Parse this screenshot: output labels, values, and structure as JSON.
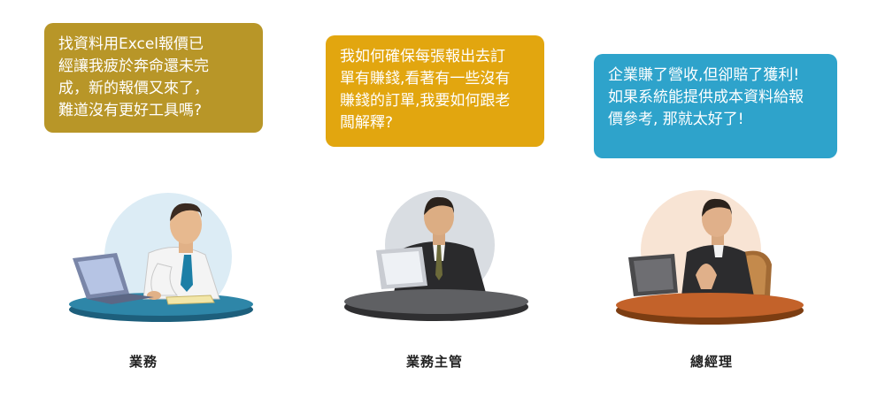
{
  "colors": {
    "bubble_sales": "#b89628",
    "bubble_supervisor": "#e2a60f",
    "bubble_manager": "#2ea3cb"
  },
  "speech": {
    "sales": {
      "lines": [
        "找資料用Excel報價已",
        "經讓我疲於奔命還未完",
        "成，新的報價又來了，",
        "難道沒有更好工具嗎?"
      ]
    },
    "supervisor": {
      "lines": [
        "我如何確保每張報出去訂",
        "單有賺錢,看著有一些沒有",
        "賺錢的訂單,我要如何跟老",
        "闆解釋?"
      ]
    },
    "manager": {
      "lines": [
        "企業賺了營收,但卻賠了獲利!",
        "如果系統能提供成本資料給報",
        "價參考, 那就太好了!"
      ]
    }
  },
  "roles": {
    "sales": "業務",
    "supervisor": "業務主管",
    "manager": "總經理"
  }
}
